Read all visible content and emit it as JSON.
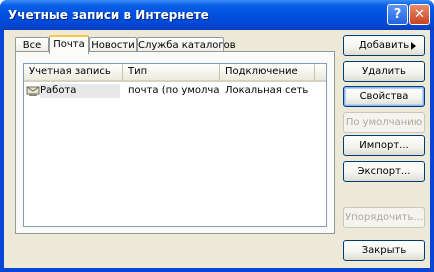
{
  "window": {
    "title": "Учетные записи в Интернете",
    "help_label": "?",
    "close_label": "✕"
  },
  "tabs": [
    {
      "label": "Все",
      "active": false
    },
    {
      "label": "Почта",
      "active": true
    },
    {
      "label": "Новости",
      "active": false
    },
    {
      "label": "Служба каталогов",
      "active": false
    }
  ],
  "list": {
    "columns": [
      "Учетная запись",
      "Тип",
      "Подключение"
    ],
    "rows": [
      {
        "account": "Работа",
        "type": "почта (по умолчан...",
        "connection": "Локальная сеть",
        "icon": "mail-account-icon"
      }
    ]
  },
  "buttons": {
    "add": "Добавить",
    "delete": "Удалить",
    "properties": "Свойства",
    "set_default": "По умолчанию",
    "import": "Импорт...",
    "export": "Экспорт...",
    "order": "Упорядочить...",
    "close": "Закрыть"
  }
}
